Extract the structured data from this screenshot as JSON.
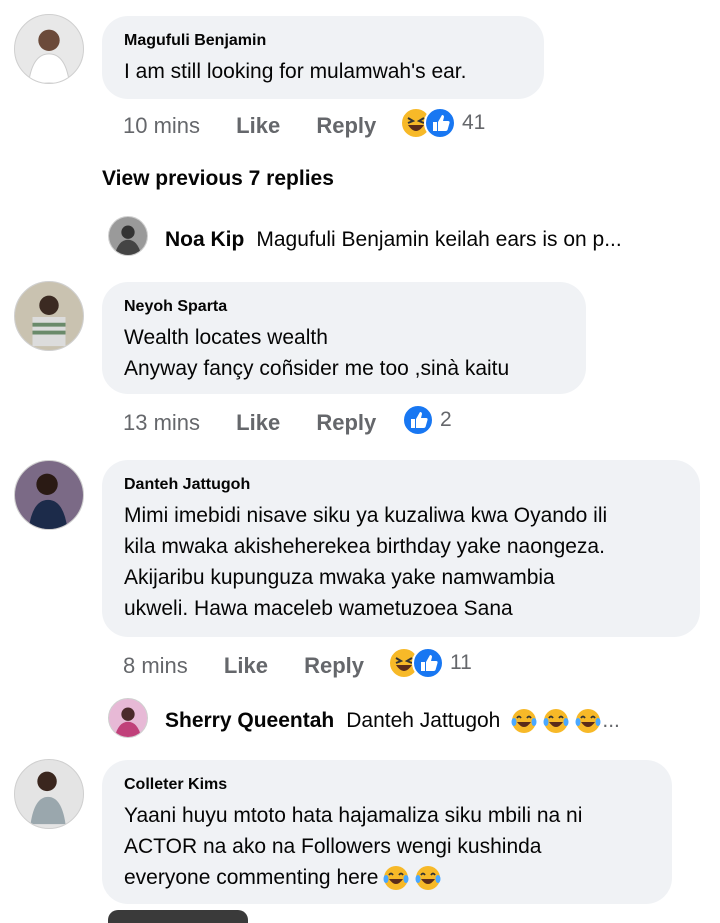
{
  "comments": [
    {
      "author": "Magufuli Benjamin",
      "text": "I am still looking for mulamwah's ear.",
      "time": "10 mins",
      "like": "Like",
      "reply": "Reply",
      "reaction_count": "41",
      "reactions": [
        "haha-icon",
        "like-icon"
      ]
    },
    {
      "author": "Neyoh Sparta",
      "text": "Wealth locates wealth\nAnyway fançy coñsider me too ,sinà kaitu",
      "time": "13 mins",
      "like": "Like",
      "reply": "Reply",
      "reaction_count": "2",
      "reactions": [
        "like-icon"
      ]
    },
    {
      "author": "Danteh Jattugoh",
      "text": "Mimi imebidi nisave siku ya kuzaliwa kwa Oyando ili\nkila mwaka akisheherekea birthday yake naongeza.\nAkijaribu kupunguza mwaka yake namwambia\nukweli. Hawa maceleb wametuzoea Sana",
      "time": "8 mins",
      "like": "Like",
      "reply": "Reply",
      "reaction_count": "11",
      "reactions": [
        "haha-icon",
        "like-icon"
      ]
    },
    {
      "author": "Colleter Kims",
      "text": "Yaani huyu mtoto hata hajamaliza siku mbili na ni\nACTOR na ako na Followers wengi kushinda\neveryone commenting here",
      "trailing_emoji": [
        "tears-of-joy-icon",
        "tears-of-joy-icon"
      ]
    }
  ],
  "view_previous": "View previous 7 replies",
  "reply_previews": [
    {
      "name": "Noa Kip",
      "snippet": "Magufuli Benjamin keilah ears is on p..."
    },
    {
      "name": "Sherry Queentah",
      "snippet": "Danteh Jattugoh",
      "emoji": [
        "tears-of-joy-icon",
        "tears-of-joy-icon",
        "tears-of-joy-icon"
      ],
      "ellipsis": "..."
    }
  ],
  "colors": {
    "bubble": "#f0f2f5",
    "meta": "#65676b",
    "like_blue": "#1877f2",
    "haha_yellow": "#f7b928"
  }
}
